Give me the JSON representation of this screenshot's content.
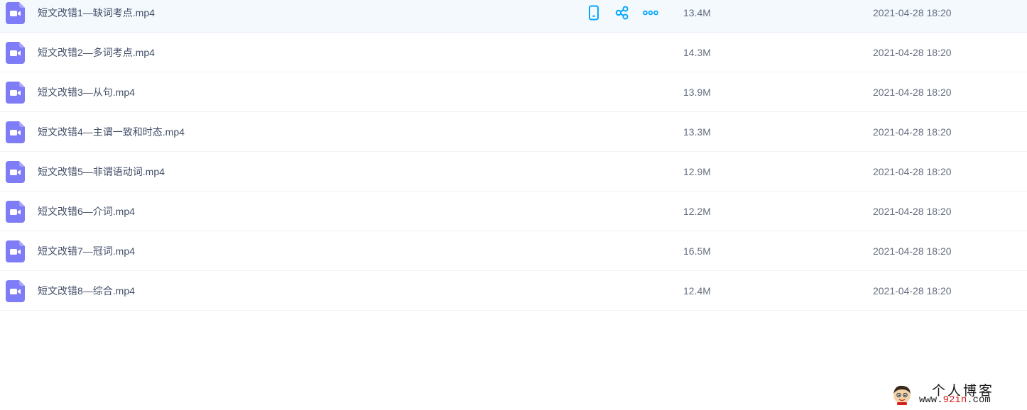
{
  "files": [
    {
      "name": "短文改错1—缺词考点.mp4",
      "size": "13.4M",
      "time": "2021-04-28 18:20",
      "icon": "video-file-icon"
    },
    {
      "name": "短文改错2—多词考点.mp4",
      "size": "14.3M",
      "time": "2021-04-28 18:20",
      "icon": "video-file-icon"
    },
    {
      "name": "短文改错3—从句.mp4",
      "size": "13.9M",
      "time": "2021-04-28 18:20",
      "icon": "video-file-icon"
    },
    {
      "name": "短文改错4—主谓一致和时态.mp4",
      "size": "13.3M",
      "time": "2021-04-28 18:20",
      "icon": "video-file-icon"
    },
    {
      "name": "短文改错5—非谓语动词.mp4",
      "size": "12.9M",
      "time": "2021-04-28 18:20",
      "icon": "video-file-icon"
    },
    {
      "name": "短文改错6—介词.mp4",
      "size": "12.2M",
      "time": "2021-04-28 18:20",
      "icon": "video-file-icon"
    },
    {
      "name": "短文改错7—冠词.mp4",
      "size": "16.5M",
      "time": "2021-04-28 18:20",
      "icon": "video-file-icon"
    },
    {
      "name": "短文改错8—综合.mp4",
      "size": "12.4M",
      "time": "2021-04-28 18:20",
      "icon": "video-file-icon"
    }
  ],
  "row_actions": [
    {
      "icon": "phone-icon"
    },
    {
      "icon": "share-icon"
    },
    {
      "icon": "more-icon"
    }
  ],
  "watermark": {
    "title": "个人博客",
    "url_prefix": "www.",
    "url_accent": "92in",
    "url_suffix": ".com"
  },
  "colors": {
    "video_icon": "#7f7cf7",
    "action_icon": "#06a7ff",
    "hover_row": "#f3f9fd",
    "text": "#424e67",
    "watermark_accent": "#d71f1f"
  }
}
